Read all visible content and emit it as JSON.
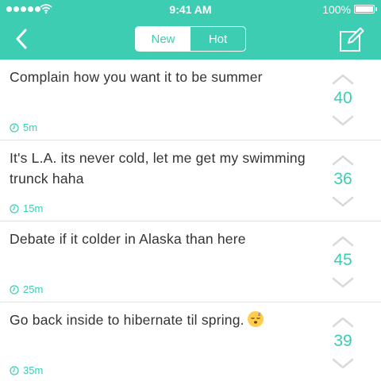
{
  "status_bar": {
    "time": "9:41 AM",
    "battery": "100%"
  },
  "nav": {
    "tabs": [
      {
        "label": "New",
        "active": true
      },
      {
        "label": "Hot",
        "active": false
      }
    ],
    "back_icon": "chevron-left-icon",
    "compose_icon": "compose-icon"
  },
  "colors": {
    "accent": "#3ccdb3",
    "text": "#333333",
    "divider": "#e2e2e2"
  },
  "posts": [
    {
      "text": "Complain how you want it to be summer",
      "time": "5m",
      "votes": "40",
      "emoji": ""
    },
    {
      "text": "It's L.A. its never cold, let me get my swimming trunck haha",
      "time": "15m",
      "votes": "36",
      "emoji": ""
    },
    {
      "text": "Debate if it colder in Alaska than here",
      "time": "25m",
      "votes": "45",
      "emoji": ""
    },
    {
      "text": "Go back inside to hibernate til spring.",
      "time": "35m",
      "votes": "39",
      "emoji": "sleeping-face"
    }
  ]
}
